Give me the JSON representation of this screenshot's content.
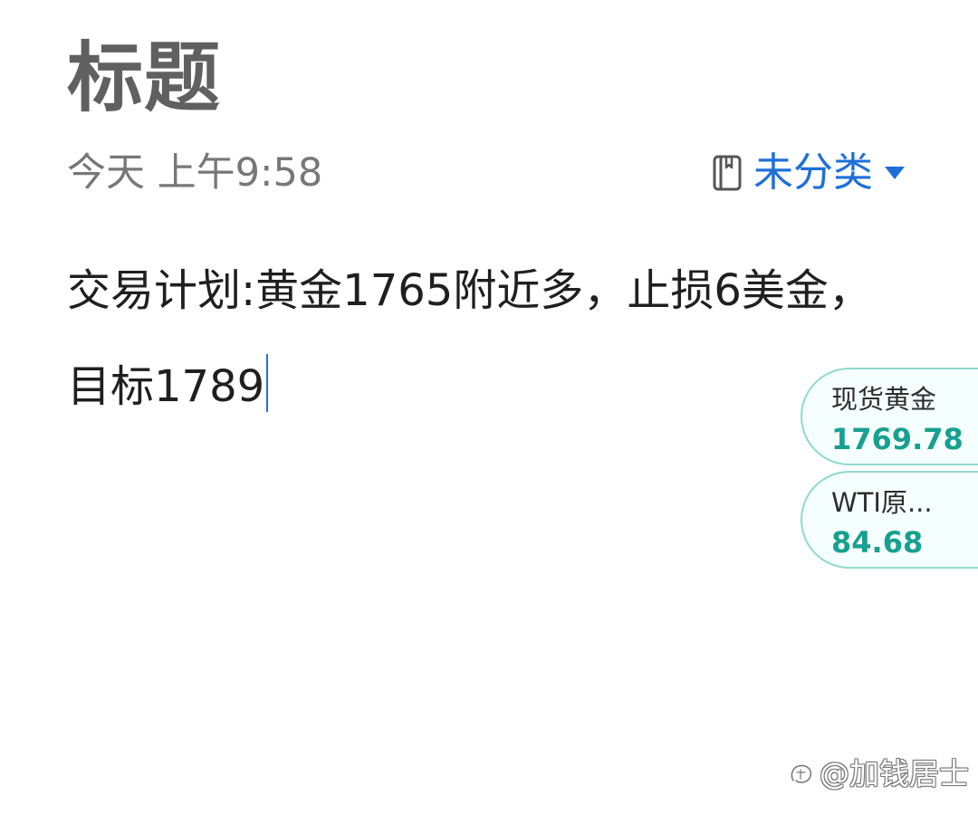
{
  "note": {
    "title": "标题",
    "timestamp": "今天 上午9:58",
    "category": {
      "label": "未分类",
      "icon": "notebook-icon",
      "dropdown_icon": "dropdown-triangle-icon",
      "accent_color": "#1e6fd9"
    },
    "body": "交易计划:黄金1765附近多，止损6美金，目标1789"
  },
  "quote_widgets": [
    {
      "name": "现货黄金",
      "price": "1769.78",
      "price_color": "#16a08f"
    },
    {
      "name": "WTI原...",
      "price": "84.68",
      "price_color": "#16a08f"
    }
  ],
  "watermark": {
    "text": "@加钱居士",
    "icon": "zhihu-logo-icon"
  }
}
